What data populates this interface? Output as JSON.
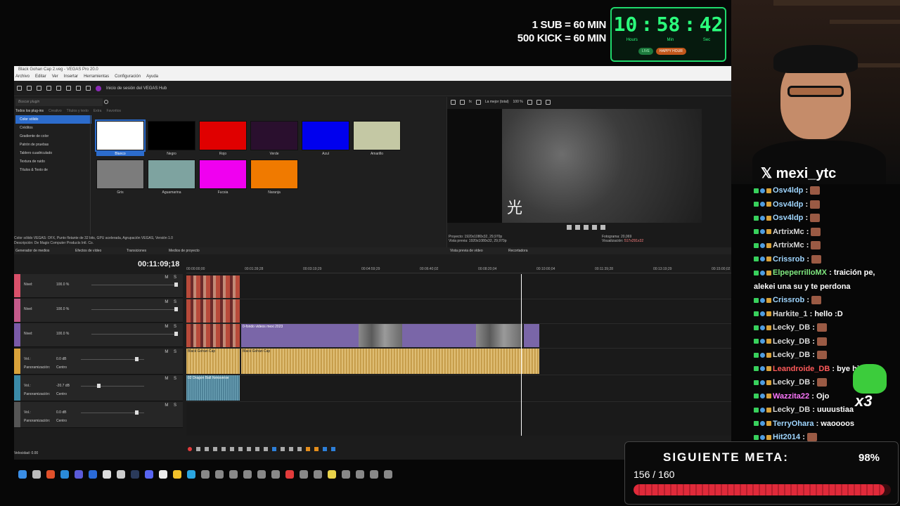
{
  "stream": {
    "promo_line1": "1 SUB = 60 MIN",
    "promo_line2": "500 KICK = 60 MIN",
    "timer": {
      "hours": "10",
      "minutes": "58",
      "seconds": "42",
      "hours_label": "Hours",
      "min_label": "Min",
      "sec_label": "Sec",
      "badge_live": "LIVE",
      "badge_happy": "HAPPY HOUR"
    },
    "handle": "𝕏 mexi_ytc"
  },
  "vegas": {
    "title": "Black Gohan Cap 2.veg - VEGAS Pro 20.0",
    "menu": [
      "Archivo",
      "Editar",
      "Ver",
      "Insertar",
      "Herramientas",
      "Configuración",
      "Ayuda"
    ],
    "hub_label": "Inicio de sesión del VEGAS Hub",
    "media_generators": {
      "search_placeholder": "Buscar plugin",
      "tabs": [
        "Todos los plug-ins",
        "Creativo",
        "Títulos y texto",
        "Extra",
        "Favoritos"
      ],
      "tree": [
        "Color sólido",
        "Créditos",
        "Gradiente de color",
        "Patrón de pruebas",
        "Tablero cuadriculado",
        "Textura de ruido",
        "Títulos & Texto de"
      ],
      "swatches": [
        {
          "label": "Blanco",
          "color": "#ffffff"
        },
        {
          "label": "Negro",
          "color": "#000000"
        },
        {
          "label": "Rojo",
          "color": "#e00000"
        },
        {
          "label": "Verde",
          "color": "#2a0f2e"
        },
        {
          "label": "Azul",
          "color": "#0000ee"
        },
        {
          "label": "Amarillo",
          "color": "#c4c8a4"
        },
        {
          "label": "Gris",
          "color": "#7c7c7c"
        },
        {
          "label": "Aguamarina",
          "color": "#7ea3a0"
        },
        {
          "label": "Fucsia",
          "color": "#f000f0"
        },
        {
          "label": "Naranja",
          "color": "#f07a00"
        }
      ],
      "desc_line1": "Color sólido VEGAS: OFX, Punto flotante de 32 bits, GPU acelerada, Agrupación VEGAS, Versión 1.0",
      "desc_line2": "Descripción: De Magix Computer Products Intl. Co."
    },
    "preview": {
      "quality": "La mejor (total)",
      "zoom": "100 %",
      "kanji": "光",
      "project": "Proyecto:      1920x1080x32, 29,970p",
      "preview_res": "Vista previa:  1920x1080x32, 29,970p",
      "frame": "Fotograma:    20,069",
      "display": "Visualización:",
      "display_val": "517x291x32"
    },
    "dock_tabs": [
      "Generador de medios",
      "Efectos de vídeo",
      "Transiciones",
      "Medios de proyecto",
      "Vista previa de vídeo",
      "Recortadora"
    ],
    "timeline": {
      "timecode": "00:11:09;18",
      "ruler": [
        "00:00:00;00",
        "00:01:39;28",
        "00:03:19;29",
        "00:04:59;29",
        "00:06:40;02",
        "00:08:20;04",
        "00:10:00;04",
        "00:11:39;28",
        "00:13:19;29",
        "00:15:00;02",
        "00:16:40;02"
      ],
      "video_tracks": [
        {
          "label": "Nivel:",
          "value": "100.0 %",
          "color": "#d9506a"
        },
        {
          "label": "Nivel:",
          "value": "100.0 %",
          "color": "#c45a8a"
        },
        {
          "label": "Nivel:",
          "value": "100.0 %",
          "color": "#7a5aa8"
        }
      ],
      "audio_tracks": [
        {
          "vol_label": "Vol.:",
          "vol": "0.0 dB",
          "pan_label": "Panoramización:",
          "pan": "Centro",
          "color": "#d9a23a"
        },
        {
          "vol_label": "Vol.:",
          "vol": "-20.7 dB",
          "pan_label": "Panoramización:",
          "pan": "Centro",
          "color": "#3a8aa8"
        },
        {
          "vol_label": "Vol.:",
          "vol": "0.0 dB",
          "pan_label": "Panoramización:",
          "pan": "Centro",
          "color": "#555555"
        }
      ],
      "clips": {
        "bg_video": "0-fondo videos mexi 2023",
        "audio_main": "Black Gohan Cap",
        "audio_small": "Black Gohan Cap",
        "dragon": "02 Dragon Ball Xenoverse"
      },
      "velocity": "Velocidad: 0.00"
    }
  },
  "chat": [
    {
      "user": "Osv4ldp",
      "color": "#9fd6ff",
      "text": ":",
      "emote": true
    },
    {
      "user": "Osv4ldp",
      "color": "#9fd6ff",
      "text": ":",
      "emote": true
    },
    {
      "user": "Osv4ldp",
      "color": "#9fd6ff",
      "text": ":",
      "emote": true
    },
    {
      "user": "ArtrixMc",
      "color": "#d8d8d8",
      "text": ":",
      "emote": true
    },
    {
      "user": "ArtrixMc",
      "color": "#d8d8d8",
      "text": ":",
      "emote": true
    },
    {
      "user": "Crissrob",
      "color": "#9fd6ff",
      "text": ":",
      "emote": true
    },
    {
      "user": "ElpeperrilloMX",
      "color": "#7fe87f",
      "text": ": traición pe,",
      "emote": false
    },
    {
      "user": "",
      "color": "#ffffff",
      "text": "alekei una su y te perdona",
      "emote": false
    },
    {
      "user": "Crissrob",
      "color": "#9fd6ff",
      "text": ":",
      "emote": true
    },
    {
      "user": "Harkite_1",
      "color": "#d8d8d8",
      "text": ": hello :D",
      "emote": false
    },
    {
      "user": "Lecky_DB",
      "color": "#d8d8d8",
      "text": ":",
      "emote": true
    },
    {
      "user": "Lecky_DB",
      "color": "#d8d8d8",
      "text": ":",
      "emote": true
    },
    {
      "user": "Lecky_DB",
      "color": "#d8d8d8",
      "text": ":",
      "emote": true
    },
    {
      "user": "Leandroide_DB",
      "color": "#ff5a5a",
      "text": ": bye hit",
      "emote": false
    },
    {
      "user": "Lecky_DB",
      "color": "#d8d8d8",
      "text": ":",
      "emote": true
    },
    {
      "user": "Wazzita22",
      "color": "#ff77ff",
      "text": ": Ojo",
      "emote": false
    },
    {
      "user": "Lecky_DB",
      "color": "#d8d8d8",
      "text": ": uuuustiaa",
      "emote": false
    },
    {
      "user": "TerryOhara",
      "color": "#9fd6ff",
      "text": ": waoooos",
      "emote": false
    },
    {
      "user": "Hit2014",
      "color": "#9fd6ff",
      "text": ":",
      "emote": true
    }
  ],
  "chat_overlay": "x3",
  "goal": {
    "title": "SIGUIENTE META:",
    "percent": "98%",
    "count": "156 / 160",
    "progress": 0.975
  }
}
